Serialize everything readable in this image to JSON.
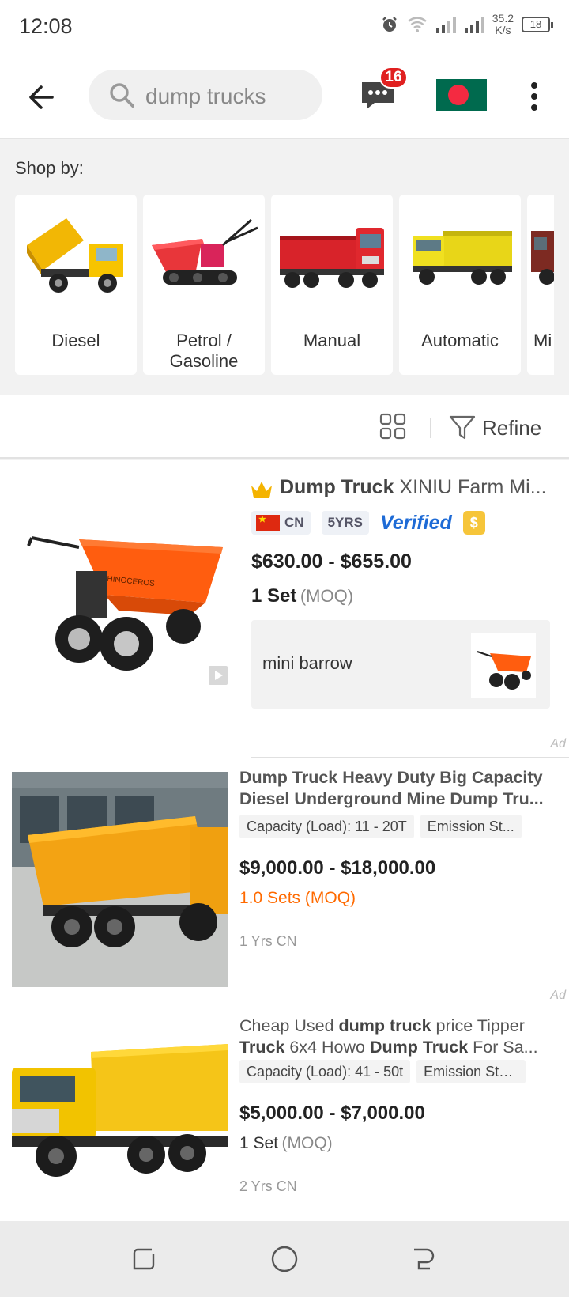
{
  "status_bar": {
    "time": "12:08",
    "net_speed_value": "35.2",
    "net_speed_unit": "K/s",
    "battery": "18"
  },
  "header": {
    "search_query": "dump trucks",
    "chat_badge": "16",
    "colors": {
      "badge": "#e02020",
      "flag_green": "#006a4e",
      "flag_red": "#f42a41"
    }
  },
  "shop_by": {
    "title": "Shop by:",
    "items": [
      {
        "label": "Diesel",
        "icon": "yellow-dump-truck-image"
      },
      {
        "label": "Petrol / Gasoline",
        "icon": "red-mini-dumper-image"
      },
      {
        "label": "Manual",
        "icon": "red-dump-truck-image"
      },
      {
        "label": "Automatic",
        "icon": "yellow-dump-truck-image"
      },
      {
        "label": "Mi",
        "icon": "dump-truck-image"
      }
    ]
  },
  "filter_bar": {
    "refine_label": "Refine"
  },
  "listings": [
    {
      "title_bold": "Dump Truck",
      "title_rest": " XINIU Farm Mi...",
      "country": "CN",
      "years": "5YRS",
      "verified": "Verified",
      "gold_symbol": "$",
      "price": "$630.00 - $655.00",
      "moq_qty": "1 Set",
      "moq_label": "(MOQ)",
      "related_label": "mini barrow",
      "image_text": "RHINOCEROS",
      "ad_label": "Ad"
    },
    {
      "title": "Dump Truck Heavy Duty Big Capacity Diesel Underground Mine Dump Tru...",
      "tags": [
        "Capacity (Load):  11 - 20T",
        "Emission St..."
      ],
      "price": "$9,000.00 - $18,000.00",
      "moq": "1.0 Sets (MOQ)",
      "supplier": "1 Yrs CN",
      "ad_label": "Ad"
    },
    {
      "title_parts": [
        "Cheap Used ",
        "dump truck",
        " price Tipper ",
        "Truck",
        " 6x4 Howo ",
        "Dump Truck",
        " For Sa..."
      ],
      "tags": [
        "Capacity (Load):  41 - 50t",
        "Emission Sta..."
      ],
      "price": "$5,000.00 - $7,000.00",
      "moq_qty": "1 Set",
      "moq_label": "(MOQ)",
      "supplier": "2 Yrs CN"
    }
  ]
}
